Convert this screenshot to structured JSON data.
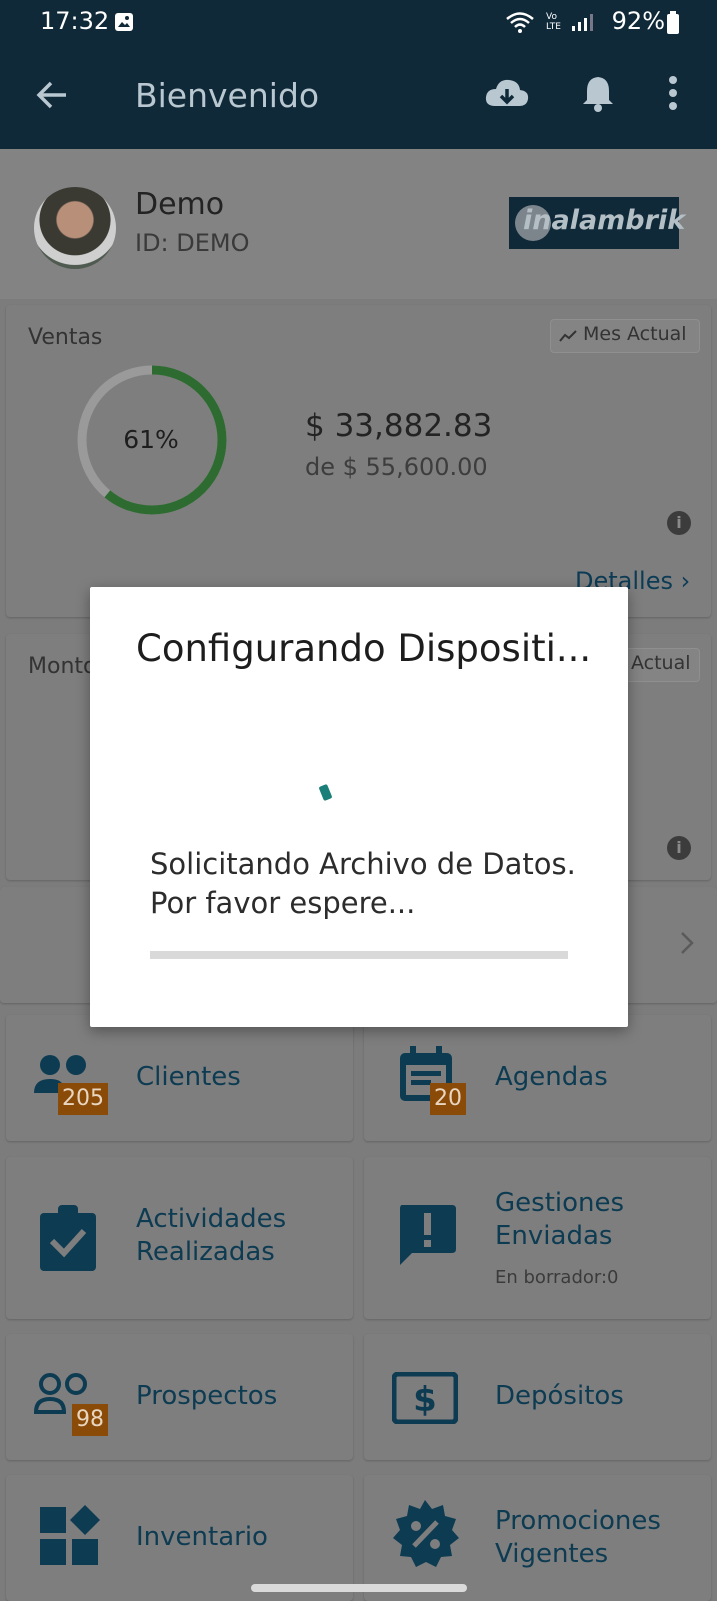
{
  "status_bar": {
    "time": "17:32",
    "network": "Vo LTE",
    "battery": "92%"
  },
  "app_bar": {
    "title": "Bienvenido"
  },
  "user": {
    "name": "Demo",
    "id": "ID: DEMO",
    "brand": "inalambrik"
  },
  "sales_card": {
    "title": "Ventas",
    "period": "Mes Actual",
    "percent_label": "61%",
    "progress": 0.61,
    "amount": "$ 33,882.83",
    "goal": "de $ 55,600.00",
    "details_link": "Detalles"
  },
  "amount_card": {
    "title": "Monto",
    "period": "Actual"
  },
  "tiles": [
    {
      "label": "Clientes",
      "badge": "205",
      "icon": "people-icon"
    },
    {
      "label": "Agendas",
      "badge": "20",
      "icon": "calendar-icon"
    },
    {
      "label": "Actividades Realizadas",
      "icon": "clipboard-check-icon"
    },
    {
      "label": "Gestiones Enviadas",
      "sub": "En borrador:0",
      "icon": "alert-message-icon"
    },
    {
      "label": "Prospectos",
      "badge": "98",
      "icon": "people-outline-icon"
    },
    {
      "label": "Depósitos",
      "icon": "dollar-bill-icon"
    },
    {
      "label": "Inventario",
      "icon": "grid-diamond-icon"
    },
    {
      "label": "Promociones Vigentes",
      "icon": "discount-badge-icon"
    }
  ],
  "dialog": {
    "title": "Configurando Dispositi...",
    "message": "Solicitando Archivo de Datos. Por favor espere...",
    "progress": 0
  },
  "colors": {
    "app_bar": "#0f2938",
    "accent": "#1a7f78",
    "badge": "#c8650e",
    "progress_ring": "#4caf50"
  }
}
